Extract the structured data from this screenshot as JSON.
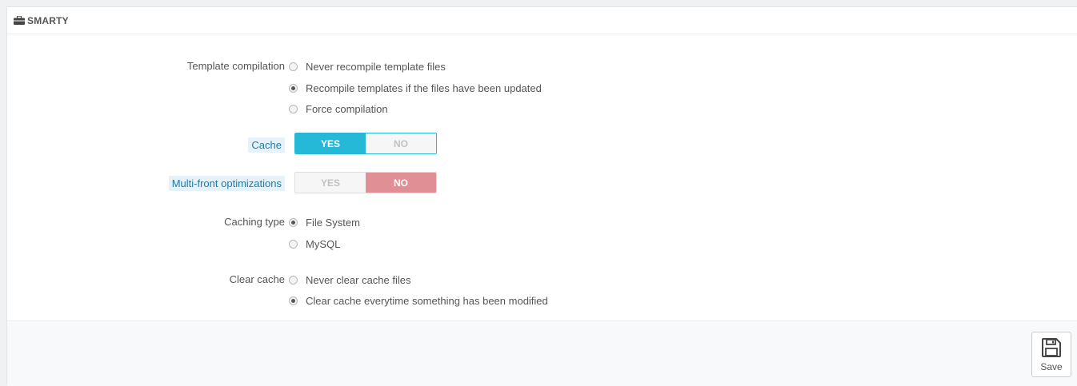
{
  "panel": {
    "title": "SMARTY",
    "title_icon": "briefcase-icon"
  },
  "template_compilation": {
    "label": "Template compilation",
    "options": [
      {
        "label": "Never recompile template files",
        "checked": false
      },
      {
        "label": "Recompile templates if the files have been updated",
        "checked": true
      },
      {
        "label": "Force compilation",
        "checked": false
      }
    ]
  },
  "cache": {
    "label": "Cache",
    "yes": "YES",
    "no": "NO",
    "value": "YES",
    "accent": "#25b9d7"
  },
  "multi_front": {
    "label": "Multi-front optimizations",
    "yes": "YES",
    "no": "NO",
    "value": "NO",
    "accent": "#e08f95"
  },
  "caching_type": {
    "label": "Caching type",
    "options": [
      {
        "label": "File System",
        "checked": true
      },
      {
        "label": "MySQL",
        "checked": false
      }
    ]
  },
  "clear_cache": {
    "label": "Clear cache",
    "options": [
      {
        "label": "Never clear cache files",
        "checked": false
      },
      {
        "label": "Clear cache everytime something has been modified",
        "checked": true
      }
    ]
  },
  "footer": {
    "save_label": "Save",
    "save_icon": "floppy-disk-icon"
  }
}
